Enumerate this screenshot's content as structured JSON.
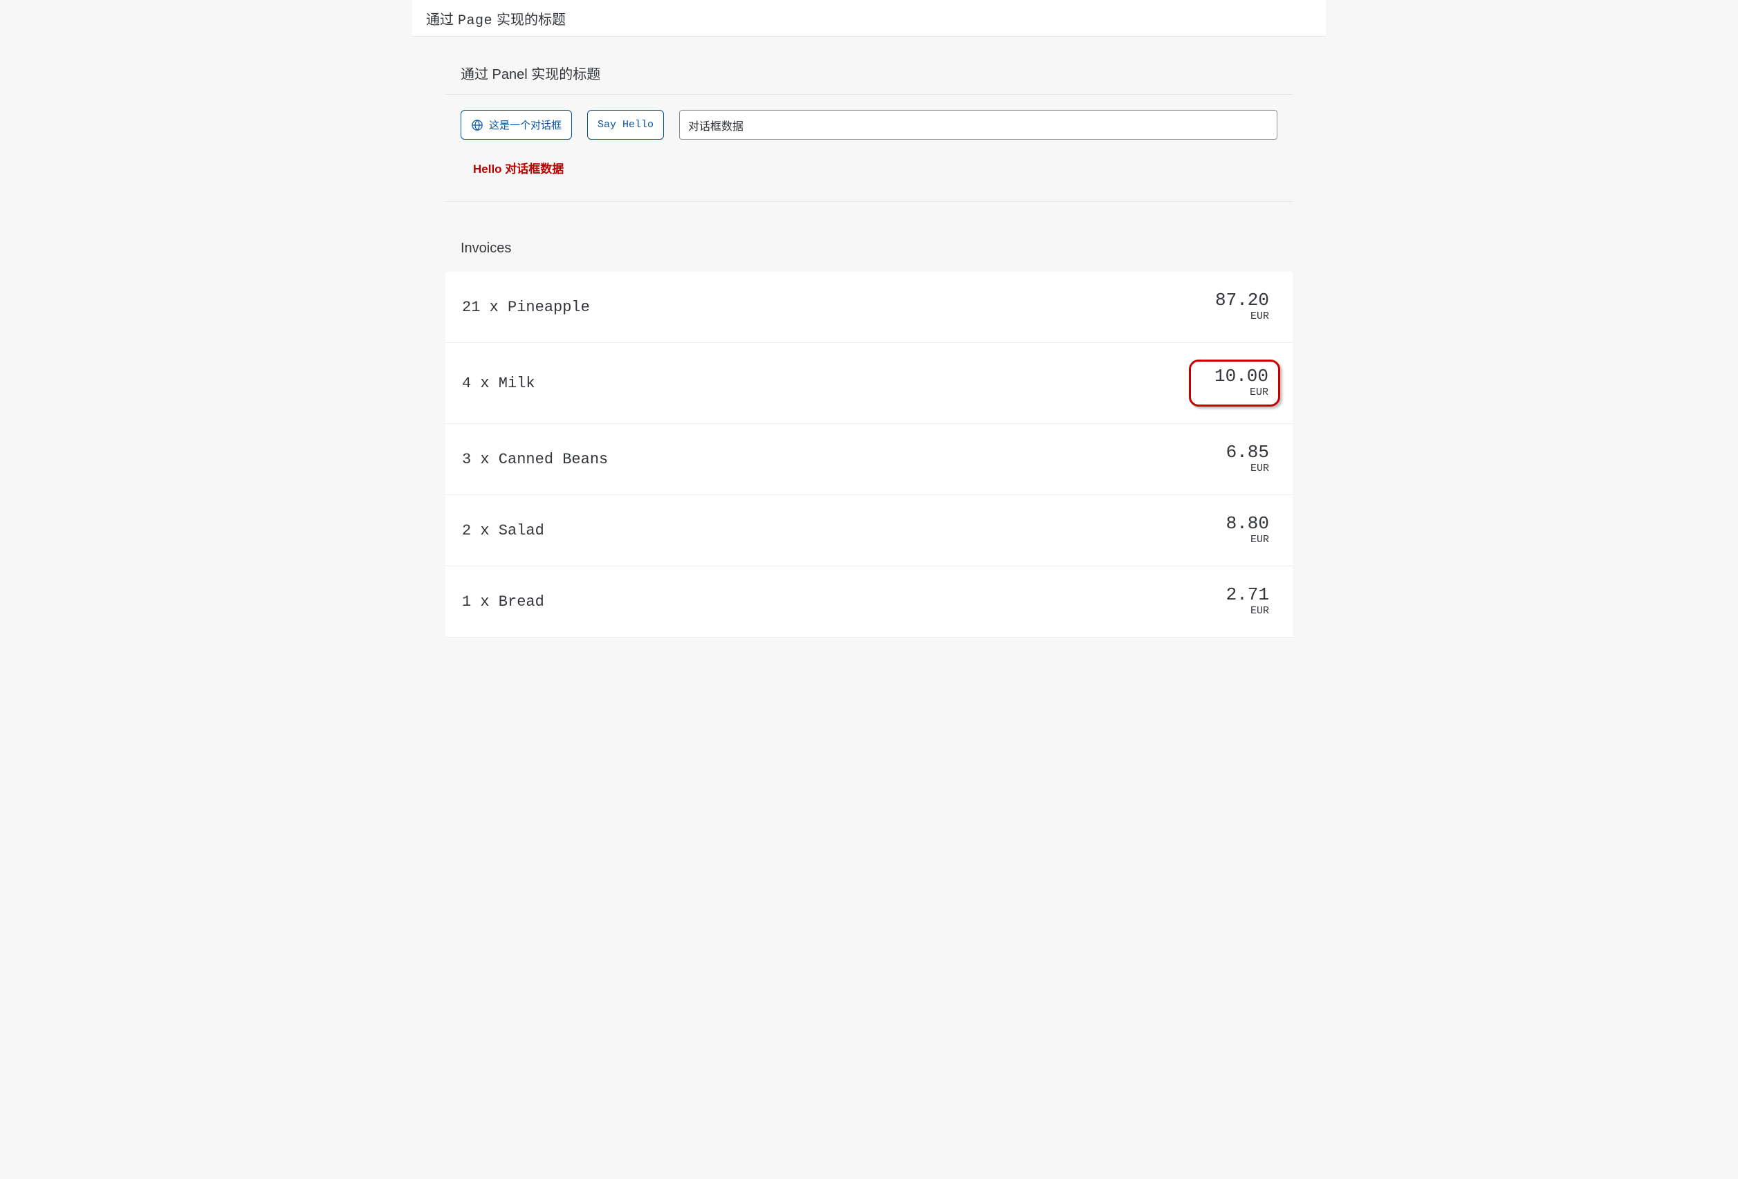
{
  "page": {
    "title_parts": [
      "通过",
      "Page",
      "实现的标题"
    ]
  },
  "panel": {
    "title": "通过 Panel 实现的标题",
    "dialog_button_label": "这是一个对话框",
    "hello_button_label": "Say Hello",
    "input_value": "对话框数据",
    "hello_text": "Hello 对话框数据"
  },
  "invoices": {
    "title": "Invoices",
    "rows": [
      {
        "desc": "21 x Pineapple",
        "amount": "87.20",
        "currency": "EUR",
        "highlight": false
      },
      {
        "desc": "4 x Milk",
        "amount": "10.00",
        "currency": "EUR",
        "highlight": true
      },
      {
        "desc": "3 x Canned Beans",
        "amount": "6.85",
        "currency": "EUR",
        "highlight": false
      },
      {
        "desc": "2 x Salad",
        "amount": "8.80",
        "currency": "EUR",
        "highlight": false
      },
      {
        "desc": "1 x Bread",
        "amount": "2.71",
        "currency": "EUR",
        "highlight": false
      }
    ]
  },
  "icons": {
    "globe": "globe-icon"
  },
  "colors": {
    "accent_blue": "#0854a0",
    "highlight_red": "#c60000",
    "error_text": "#b00"
  }
}
